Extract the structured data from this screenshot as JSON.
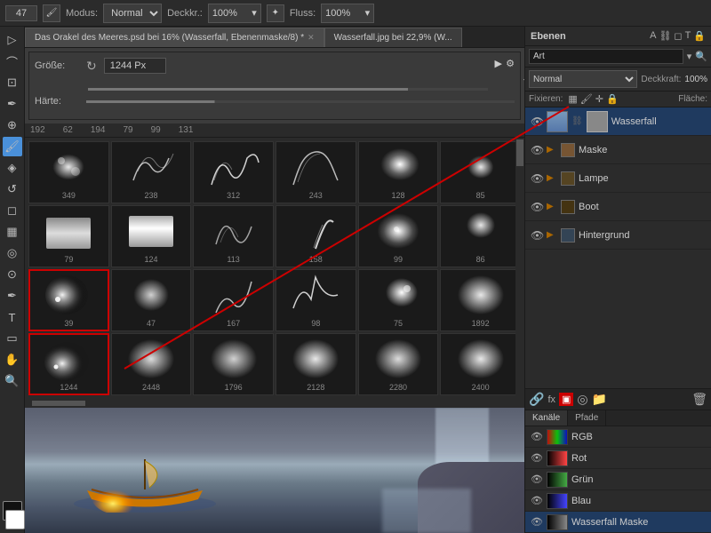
{
  "topToolbar": {
    "number": "47",
    "modusLabel": "Modus:",
    "modusValue": "Normal",
    "deckkraftLabel": "Deckkr.:",
    "deckkraftValue": "100%",
    "flussLabel": "Fluss:",
    "flussValue": "100%"
  },
  "docTabs": [
    {
      "name": "tab-orakel",
      "label": "Das Orakel des Meeres.psd bei 16% (Wasserfall, Ebenenmaske/8) *",
      "active": true,
      "closable": true
    },
    {
      "name": "tab-wasserfall",
      "label": "Wasserfall.jpg bei 22,9% (W...",
      "active": false,
      "closable": false
    }
  ],
  "brushPanel": {
    "sizeLabel": "Größe:",
    "sizeValue": "1244 Px",
    "harteLabel": "Härte:",
    "gearIcon": "⚙"
  },
  "brushGrid": {
    "headerValues": [
      "192",
      "62",
      "194",
      "79",
      "99",
      "131"
    ],
    "row1": [
      {
        "number": "349"
      },
      {
        "number": "238"
      },
      {
        "number": "312"
      },
      {
        "number": "243"
      },
      {
        "number": "128"
      },
      {
        "number": "85"
      }
    ],
    "row2": [
      {
        "number": "79"
      },
      {
        "number": "124"
      },
      {
        "number": "113"
      },
      {
        "number": "158"
      },
      {
        "number": "99"
      },
      {
        "number": "86"
      }
    ],
    "row3": [
      {
        "number": "39",
        "selected": true
      },
      {
        "number": "47"
      },
      {
        "number": "167"
      },
      {
        "number": "98"
      },
      {
        "number": "75"
      },
      {
        "number": "1892"
      }
    ],
    "row4": [
      {
        "number": "1244",
        "selected": true
      },
      {
        "number": "2448"
      },
      {
        "number": "1796"
      },
      {
        "number": "2128"
      },
      {
        "number": "2280"
      },
      {
        "number": "2400"
      }
    ]
  },
  "rightPanel": {
    "title": "Ebenen",
    "searchPlaceholder": "Art",
    "icons": [
      "A",
      "T",
      "fx",
      "🔒"
    ],
    "blendMode": "Normal",
    "opacityLabel": "Deckkraft:",
    "opacityValue": "100%",
    "flaecheLabel": "Fläche:",
    "fixierenLabel": "Fixieren:",
    "layers": [
      {
        "name": "Wasserfall",
        "type": "masked",
        "active": true,
        "visible": true,
        "hasMask": true
      },
      {
        "name": "Maske",
        "type": "group",
        "active": false,
        "visible": true,
        "hasMask": false
      },
      {
        "name": "Lampe",
        "type": "group",
        "active": false,
        "visible": true,
        "hasMask": false
      },
      {
        "name": "Boot",
        "type": "group",
        "active": false,
        "visible": true,
        "hasMask": false
      },
      {
        "name": "Hintergrund",
        "type": "group",
        "active": false,
        "visible": true,
        "hasMask": false
      }
    ],
    "bottomIcons": [
      "🔗",
      "fx",
      "▣",
      "◎",
      "🗑"
    ]
  },
  "channelsPanel": {
    "tabs": [
      "Kanäle",
      "Pfade"
    ],
    "activeTab": "Kanäle",
    "channels": [
      {
        "name": "RGB",
        "color": "#888"
      },
      {
        "name": "Rot",
        "color": "#884444"
      },
      {
        "name": "Grün",
        "color": "#448844"
      },
      {
        "name": "Blau",
        "color": "#444488"
      },
      {
        "name": "Wasserfall Maske",
        "color": "#888"
      }
    ]
  },
  "leftTools": [
    "✱",
    "◈",
    "∿",
    "▷",
    "⬚",
    "⟲",
    "⊘",
    "T",
    "▭",
    "✋",
    "🔍",
    "👁",
    "■"
  ]
}
